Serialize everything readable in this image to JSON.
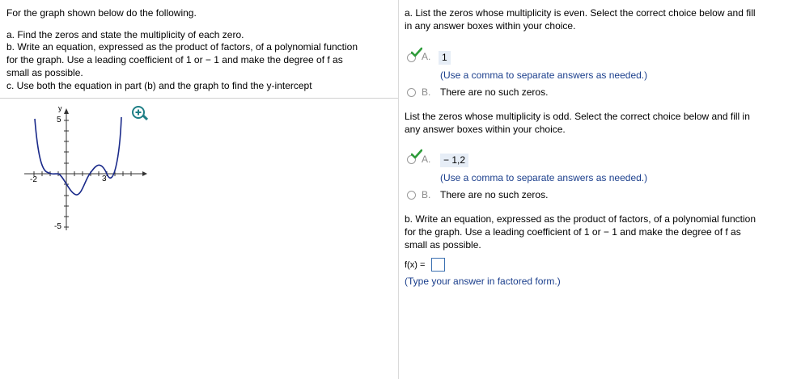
{
  "left": {
    "intro": "For the graph shown below do the following.",
    "part_a": "a. Find the zeros and state the multiplicity of each zero.",
    "part_b_line1": "b. Write an equation, expressed as the product of factors, of a polynomial function",
    "part_b_line2": "for the graph. Use a leading coefficient of 1 or − 1 and make the degree of f as",
    "part_b_line3": "small as possible.",
    "part_c": "c. Use both the equation in part (b) and the graph to find the y-intercept",
    "graph": {
      "y_axis_label": "y",
      "tick_y_top": "5",
      "tick_y_bottom": "-5",
      "tick_x_left": "-2",
      "tick_x_right": "3"
    }
  },
  "right": {
    "q1_line1": "a. List the zeros whose multiplicity is even. Select the correct choice below and fill",
    "q1_line2": "in any answer boxes within your choice.",
    "q1_choiceA_letter": "A.",
    "q1_answer": "1",
    "q1_hint": "(Use a comma to separate answers as needed.)",
    "q1_choiceB_letter": "B.",
    "q1_choiceB_text": "There are no such zeros.",
    "q2_line1": "List the zeros whose multiplicity is odd. Select the correct choice below and fill in",
    "q2_line2": "any answer boxes within your choice.",
    "q2_choiceA_letter": "A.",
    "q2_answer": "− 1,2",
    "q2_hint": "(Use a comma to separate answers as needed.)",
    "q2_choiceB_letter": "B.",
    "q2_choiceB_text": "There are no such zeros.",
    "q3_line1": "b. Write an equation, expressed as the product of factors, of a polynomial function",
    "q3_line2": "for the graph. Use a leading coefficient of 1 or − 1 and make the degree of f as",
    "q3_line3": "small as possible.",
    "fx_label": "f(x) =",
    "fx_hint": "(Type your answer in factored form.)"
  },
  "colors": {
    "check": "#2e9c3a",
    "accent_blue": "#1a3e8c",
    "answer_bg": "#e6edf6",
    "zoom": "#1f7f86"
  }
}
